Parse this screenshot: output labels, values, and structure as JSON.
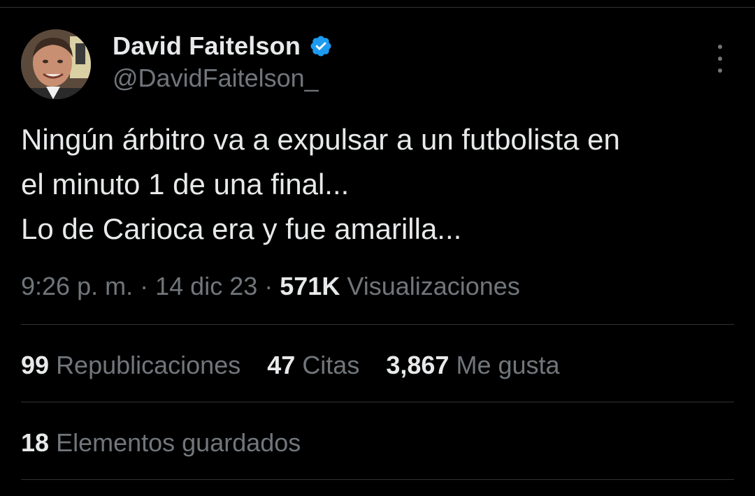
{
  "author": {
    "display_name": "David Faitelson",
    "handle": "@DavidFaitelson_",
    "verified_icon": "verified-badge-icon",
    "verified_color": "#1d9bf0"
  },
  "tweet": {
    "text": "Ningún árbitro va a expulsar a un futbolista en\nel minuto 1 de una final...\nLo de Carioca era y fue amarilla..."
  },
  "meta": {
    "time": "9:26 p. m.",
    "separator": "·",
    "date": "14 dic 23",
    "views_count": "571K",
    "views_label": "Visualizaciones"
  },
  "stats": {
    "reposts_count": "99",
    "reposts_label": "Republicaciones",
    "quotes_count": "47",
    "quotes_label": "Citas",
    "likes_count": "3,867",
    "likes_label": "Me gusta",
    "bookmarks_count": "18",
    "bookmarks_label": "Elementos guardados"
  },
  "icons": {
    "more": "more-options-icon"
  }
}
